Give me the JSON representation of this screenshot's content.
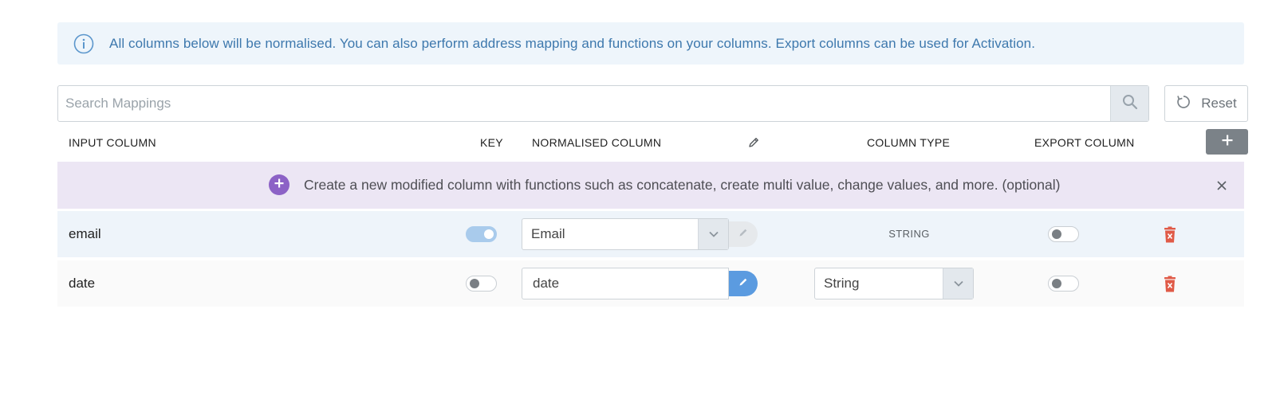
{
  "info_banner": {
    "text": "All columns below will be normalised. You can also perform address mapping and functions on your columns. Export columns can be used for Activation."
  },
  "search": {
    "placeholder": "Search Mappings",
    "value": ""
  },
  "reset_label": "Reset",
  "headers": {
    "input_column": "INPUT COLUMN",
    "key": "KEY",
    "normalised_column": "NORMALISED COLUMN",
    "column_type": "COLUMN TYPE",
    "export_column": "EXPORT COLUMN"
  },
  "function_banner": {
    "text": "Create a new modified column with functions such as concatenate, create multi value, change values, and more. (optional)"
  },
  "rows": [
    {
      "input_column": "email",
      "key": true,
      "normalised_column": "Email",
      "column_type": "STRING",
      "export": false
    },
    {
      "input_column": "date",
      "key": false,
      "normalised_column": "date",
      "column_type": "String",
      "export": false
    }
  ],
  "colors": {
    "info_text": "#3d78ad",
    "function_banner_bg": "#ece6f4",
    "function_plus": "#8c62c6",
    "edit_active": "#5b9be0",
    "delete": "#e05a47"
  }
}
